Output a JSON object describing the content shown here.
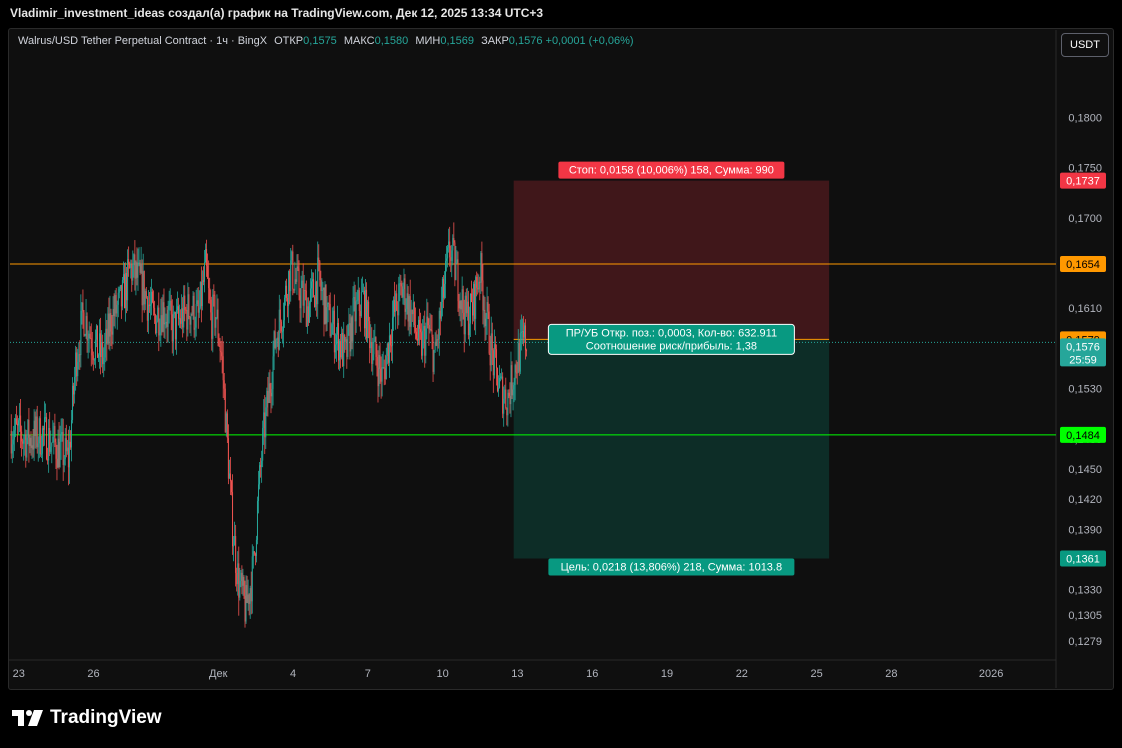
{
  "header": {
    "caption": "Vladimir_investment_ideas создал(а) график на TradingView.com, Дек 12, 2025 13:34 UTC+3"
  },
  "legend": {
    "symbol": "Walrus/USD Tether Perpetual Contract · 1ч · BingX",
    "open_label": "ОТКР",
    "open": "0,1575",
    "high_label": "МАКС",
    "high": "0,1580",
    "low_label": "МИН",
    "low": "0,1569",
    "close_label": "ЗАКР",
    "close": "0,1576",
    "change": "+0,0001 (+0,06%)"
  },
  "currency_button": "USDT",
  "brand": "TradingView",
  "colors": {
    "up": "#26a69a",
    "down": "#ef5350",
    "stop": "#f23645",
    "target": "#089981",
    "entry_line": "#ff9800",
    "level_orange": "#ff9800",
    "level_green": "#00ff00"
  },
  "chart_data": {
    "type": "candlestick",
    "timeframe": "1h",
    "ylim": [
      0.1262,
      0.1855
    ],
    "y_ticks": [
      "0,1800",
      "0,1750",
      "0,1700",
      "0,1610",
      "0,1530",
      "0,1480",
      "0,1450",
      "0,1420",
      "0,1390",
      "0,1330",
      "0,1305",
      "0,1279"
    ],
    "y_tick_values": [
      0.18,
      0.175,
      0.17,
      0.161,
      0.153,
      0.148,
      0.145,
      0.142,
      0.139,
      0.133,
      0.1305,
      0.1279
    ],
    "x_ticks": [
      "23",
      "26",
      "Дек",
      "4",
      "7",
      "10",
      "13",
      "16",
      "19",
      "22",
      "25",
      "28",
      "2026"
    ],
    "x_tick_days": [
      -8,
      -5,
      0,
      3,
      6,
      9,
      12,
      15,
      18,
      21,
      24,
      27,
      31
    ],
    "x_day_range": [
      -8.35,
      33.6
    ],
    "anchors_day_close": [
      [
        -8.3,
        0.1488
      ],
      [
        -7.6,
        0.148
      ],
      [
        -7.0,
        0.1485
      ],
      [
        -6.4,
        0.147
      ],
      [
        -6.0,
        0.146
      ],
      [
        -5.7,
        0.156
      ],
      [
        -5.4,
        0.1605
      ],
      [
        -5.0,
        0.1575
      ],
      [
        -4.6,
        0.156
      ],
      [
        -4.3,
        0.16
      ],
      [
        -3.9,
        0.1615
      ],
      [
        -3.5,
        0.165
      ],
      [
        -3.0,
        0.163
      ],
      [
        -2.6,
        0.16
      ],
      [
        -2.2,
        0.161
      ],
      [
        -1.8,
        0.159
      ],
      [
        -1.5,
        0.16
      ],
      [
        -1.1,
        0.161
      ],
      [
        -0.8,
        0.16
      ],
      [
        -0.5,
        0.165
      ],
      [
        -0.3,
        0.16
      ],
      [
        -0.1,
        0.1605
      ],
      [
        0.15,
        0.156
      ],
      [
        0.35,
        0.148
      ],
      [
        0.55,
        0.14
      ],
      [
        0.8,
        0.134
      ],
      [
        1.1,
        0.131
      ],
      [
        1.4,
        0.135
      ],
      [
        1.6,
        0.142
      ],
      [
        1.8,
        0.148
      ],
      [
        2.0,
        0.152
      ],
      [
        2.3,
        0.158
      ],
      [
        2.6,
        0.161
      ],
      [
        2.9,
        0.165
      ],
      [
        3.2,
        0.163
      ],
      [
        3.6,
        0.161
      ],
      [
        4.0,
        0.164
      ],
      [
        4.4,
        0.16
      ],
      [
        4.8,
        0.158
      ],
      [
        5.1,
        0.156
      ],
      [
        5.4,
        0.16
      ],
      [
        5.8,
        0.162
      ],
      [
        6.2,
        0.157
      ],
      [
        6.6,
        0.154
      ],
      [
        7.0,
        0.16
      ],
      [
        7.4,
        0.163
      ],
      [
        7.8,
        0.16
      ],
      [
        8.1,
        0.157
      ],
      [
        8.4,
        0.159
      ],
      [
        8.7,
        0.156
      ],
      [
        9.0,
        0.162
      ],
      [
        9.3,
        0.167
      ],
      [
        9.6,
        0.164
      ],
      [
        9.9,
        0.16
      ],
      [
        10.2,
        0.161
      ],
      [
        10.5,
        0.165
      ],
      [
        10.7,
        0.161
      ],
      [
        11.0,
        0.156
      ],
      [
        11.3,
        0.153
      ],
      [
        11.6,
        0.152
      ],
      [
        12.0,
        0.156
      ],
      [
        12.3,
        0.1578
      ],
      [
        12.4,
        0.1576
      ]
    ],
    "position": {
      "kind": "short",
      "entry": 0.1579,
      "stop": 0.1737,
      "target": 0.1361,
      "start_day": 11.85,
      "end_day": 24.5,
      "stop_label": "Стоп: 0,0158 (10,006%) 158, Сумма: 990",
      "target_label": "Цель: 0,0218 (13,806%) 218, Сумма: 1013.8",
      "pnl_label_1": "ПР/УБ Откр. поз.: 0,0003, Кол-во: 632.911",
      "pnl_label_2": "Соотношение риск/прибыль: 1,38"
    },
    "horizontal_levels": [
      {
        "value": 0.1654,
        "label": "0,1654",
        "color": "#ff9800"
      },
      {
        "value": 0.1484,
        "label": "0,1484",
        "color": "#00ff00"
      }
    ],
    "price_badges": {
      "stop": "0,1737",
      "entry": "0,1579",
      "last": "0,1576",
      "countdown": "25:59",
      "target": "0,1361"
    },
    "last_price": 0.1576
  }
}
